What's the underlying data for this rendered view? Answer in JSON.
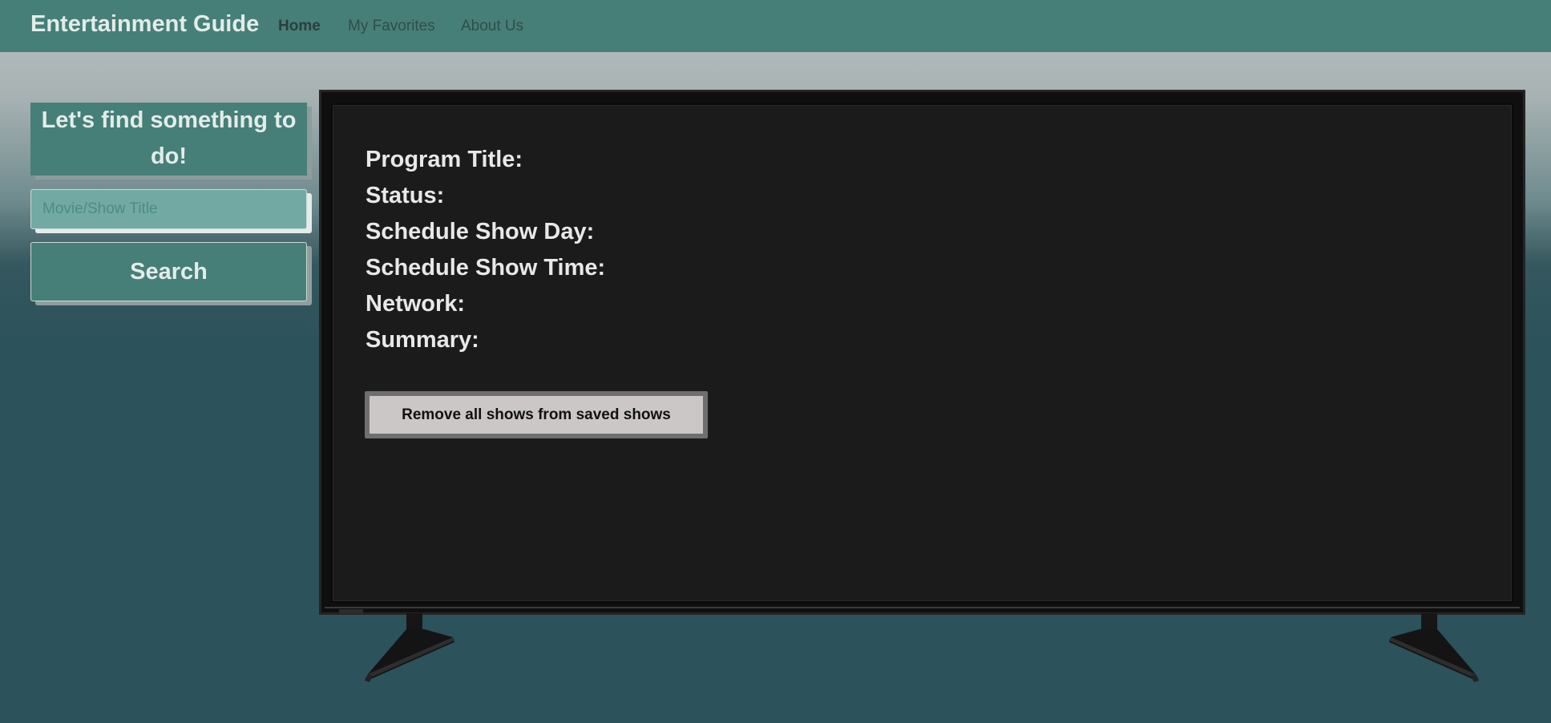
{
  "nav": {
    "brand": "Entertainment Guide",
    "links": [
      {
        "label": "Home",
        "active": true
      },
      {
        "label": "My Favorites",
        "active": false
      },
      {
        "label": "About Us",
        "active": false
      }
    ]
  },
  "sidebar": {
    "heading": "Let's find something to do!",
    "search_placeholder": "Movie/Show Title",
    "search_value": "",
    "search_button": "Search"
  },
  "details": {
    "program_title_label": "Program Title:",
    "status_label": "Status:",
    "schedule_day_label": "Schedule Show Day:",
    "schedule_time_label": "Schedule Show Time:",
    "network_label": "Network:",
    "summary_label": "Summary:",
    "remove_button": "Remove all shows from saved shows"
  },
  "colors": {
    "navbar": "#467f77",
    "accent": "#467f77",
    "tv_screen": "#1b1b1b"
  }
}
